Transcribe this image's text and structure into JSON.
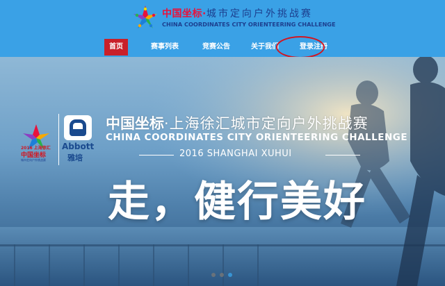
{
  "header": {
    "logo_cn_red": "中国坐标·",
    "logo_cn_blue": "城市定向户外挑战赛",
    "logo_en": "CHINA COORDINATES CITY ORIENTEERING CHALLENGE"
  },
  "nav": {
    "items": [
      {
        "label": "首页",
        "active": true
      },
      {
        "label": "赛事列表",
        "active": false
      },
      {
        "label": "竞赛公告",
        "active": false
      },
      {
        "label": "关于我们",
        "active": false
      },
      {
        "label": "登录注册",
        "active": false
      }
    ]
  },
  "banner": {
    "small_logo_year": "2016 上海徐汇",
    "small_logo_cn": "中国坐标",
    "small_logo_sub": "城市定向户外挑战赛",
    "sponsor_name": "Abbott",
    "sponsor_cn": "雅培",
    "title_cn_bold": "中国坐标",
    "title_cn_rest": "·上海徐汇城市定向户外挑战赛",
    "title_en": "CHINA COORDINATES  CITY ORIENTEERING CHALLENGE",
    "subtitle": "2016   SHANGHAI XUHUI",
    "slogan": "走，健行美好"
  },
  "carousel": {
    "slides": 3,
    "active_index": 2
  },
  "colors": {
    "header_bg": "#3aa1e6",
    "nav_active": "#c9202a",
    "highlight_ring": "#d3151f"
  }
}
